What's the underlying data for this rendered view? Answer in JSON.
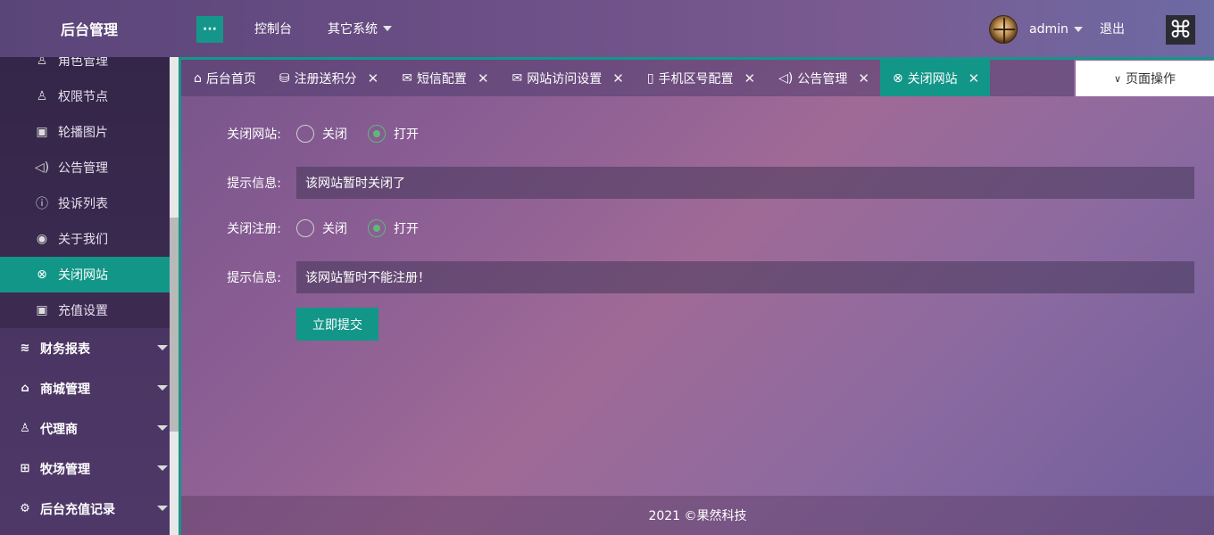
{
  "header": {
    "logo": "后台管理",
    "menu_toggle": "···",
    "nav": [
      "控制台",
      "其它系统"
    ],
    "user": "admin",
    "logout": "退出",
    "brand_glyph": "⌘"
  },
  "sidebar": {
    "sub_items": [
      {
        "label": "角色管理",
        "icon": "user-role-icon",
        "glyph": "♙"
      },
      {
        "label": "权限节点",
        "icon": "user-icon",
        "glyph": "♙"
      },
      {
        "label": "轮播图片",
        "icon": "image-icon",
        "glyph": "▣"
      },
      {
        "label": "公告管理",
        "icon": "speaker-icon",
        "glyph": "◁)"
      },
      {
        "label": "投诉列表",
        "icon": "alert-icon",
        "glyph": "ⓘ"
      },
      {
        "label": "关于我们",
        "icon": "user-circle-icon",
        "glyph": "◉"
      },
      {
        "label": "关闭网站",
        "icon": "close-circle-icon",
        "glyph": "⊗",
        "active": true
      },
      {
        "label": "充值设置",
        "icon": "image-icon",
        "glyph": "▣"
      }
    ],
    "groups": [
      {
        "label": "财务报表",
        "icon": "chart-icon",
        "glyph": "≋"
      },
      {
        "label": "商城管理",
        "icon": "shop-icon",
        "glyph": "⌂"
      },
      {
        "label": "代理商",
        "icon": "user-icon",
        "glyph": "♙"
      },
      {
        "label": "牧场管理",
        "icon": "gift-icon",
        "glyph": "⊞"
      },
      {
        "label": "后台充值记录",
        "icon": "gear-icon",
        "glyph": "⚙"
      }
    ]
  },
  "tabs": [
    {
      "label": "后台首页",
      "icon": "home-icon",
      "glyph": "⌂",
      "closable": false
    },
    {
      "label": "注册送积分",
      "icon": "database-icon",
      "glyph": "⛁",
      "closable": true
    },
    {
      "label": "短信配置",
      "icon": "mail-icon",
      "glyph": "✉",
      "closable": true
    },
    {
      "label": "网站访问设置",
      "icon": "mail-icon",
      "glyph": "✉",
      "closable": true
    },
    {
      "label": "手机区号配置",
      "icon": "phone-icon",
      "glyph": "▯",
      "closable": true
    },
    {
      "label": "公告管理",
      "icon": "speaker-icon",
      "glyph": "◁)",
      "closable": true
    },
    {
      "label": "关闭网站",
      "icon": "close-circle-icon",
      "glyph": "⊗",
      "closable": true,
      "active": true
    }
  ],
  "tab_close_glyph": "✕",
  "page_ops": {
    "label": "页面操作",
    "chevron": "∨"
  },
  "form": {
    "close_site": {
      "label": "关闭网站:",
      "options": [
        "关闭",
        "打开"
      ],
      "selected": "打开"
    },
    "site_msg": {
      "label": "提示信息:",
      "value": "该网站暂时关闭了"
    },
    "close_register": {
      "label": "关闭注册:",
      "options": [
        "关闭",
        "打开"
      ],
      "selected": "打开"
    },
    "register_msg": {
      "label": "提示信息:",
      "value": "该网站暂时不能注册！"
    },
    "submit": "立即提交"
  },
  "footer": "2021 ©果然科技",
  "colors": {
    "accent": "#129688",
    "radio_checked": "#5fb878"
  }
}
